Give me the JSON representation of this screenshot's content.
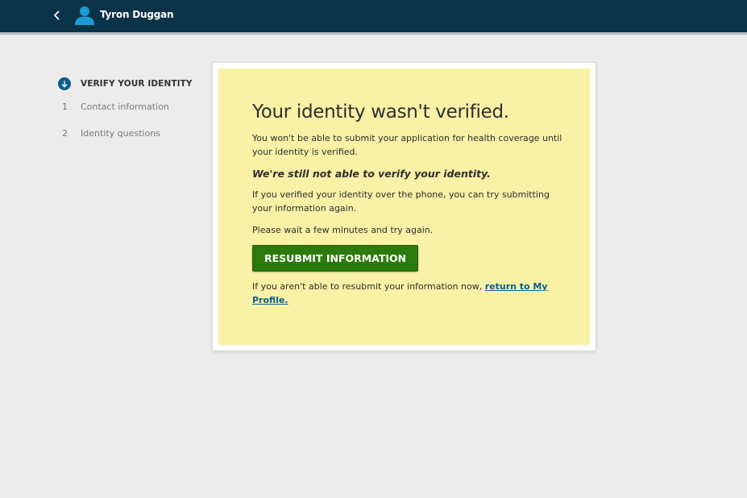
{
  "header": {
    "back_icon": "chevron-left-icon",
    "user_icon": "user-icon",
    "user_name": "Tyron Duggan",
    "background_color": "#0b3347",
    "user_icon_color": "#1d9bd6"
  },
  "steps": {
    "current": {
      "icon": "arrow-down-circle-icon",
      "label": "VERIFY YOUR IDENTITY"
    },
    "items": [
      {
        "number": "1",
        "label": "Contact information"
      },
      {
        "number": "2",
        "label": "Identity questions"
      }
    ]
  },
  "alert": {
    "title": "Your identity wasn't verified.",
    "message": "You won't be able to submit your application for health coverage until your identity is verified.",
    "emphasis": "We're still not able to verify your identity.",
    "phone_note": "If you verified your identity over the phone, you can try submitting your information again.",
    "wait_note": "Please wait a few minutes and try again.",
    "button_label": "RESUBMIT INFORMATION",
    "footer_prefix": "If you aren't able to resubmit your information now, ",
    "footer_link": "return to My Profile.",
    "background_color": "#f8f1a6",
    "button_color": "#2b7a0b",
    "link_color": "#0b5d8c"
  }
}
